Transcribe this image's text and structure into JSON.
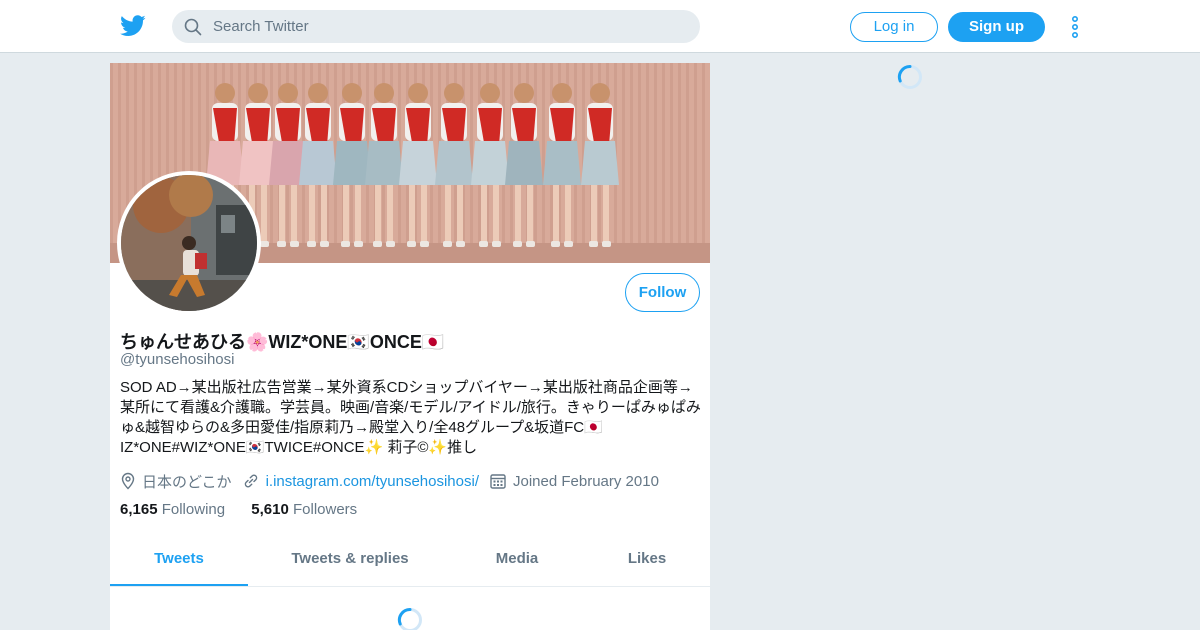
{
  "header": {
    "search_placeholder": "Search Twitter",
    "login_label": "Log in",
    "signup_label": "Sign up"
  },
  "profile": {
    "name": "ちゅんせあひる🌸WIZ*ONE🇰🇷ONCE🇯🇵",
    "handle": "@tyunsehosihosi",
    "bio": "SOD AD→某出版社広告営業→某外資系CDショップバイヤー→某出版社商品企画等→某所にて看護&介護職。学芸員。映画/音楽/モデル/アイドル/旅行。きゃりーぱみゅぱみゅ&越智ゆらの&多田愛佳/指原莉乃→殿堂入り/全48グループ&坂道FC🇯🇵IZ*ONE#WIZ*ONE🇰🇷TWICE#ONCE✨ 莉子©✨推し",
    "location": "日本のどこか",
    "website": "i.instagram.com/tyunsehosihosi/",
    "joined": "Joined February 2010",
    "following_count": "6,165",
    "following_label": "Following",
    "followers_count": "5,610",
    "followers_label": "Followers",
    "follow_button": "Follow"
  },
  "tabs": [
    {
      "label": "Tweets",
      "active": true
    },
    {
      "label": "Tweets & replies",
      "active": false
    },
    {
      "label": "Media",
      "active": false
    },
    {
      "label": "Likes",
      "active": false
    }
  ],
  "colors": {
    "accent": "#1da1f2",
    "background": "#e6ecf0",
    "secondary_text": "#657786"
  },
  "icons": [
    "twitter-bird-icon",
    "search-icon",
    "more-vertical-icon",
    "location-pin-icon",
    "link-icon",
    "calendar-icon",
    "loading-spinner-icon"
  ]
}
